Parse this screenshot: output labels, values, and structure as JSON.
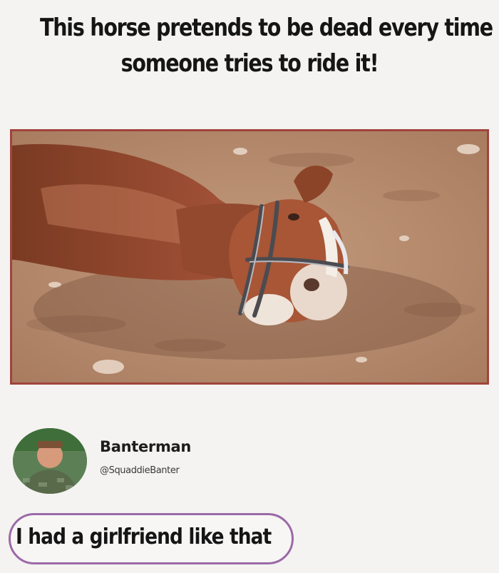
{
  "meme": {
    "headline_line1": "This horse pretends to be dead every time",
    "headline_line2": "someone tries to ride it!"
  },
  "post": {
    "username": "Banterman",
    "handle": "@SquaddieBanter",
    "comment": "I had a girlfriend like that"
  },
  "colors": {
    "photo_border": "#a0443c",
    "comment_border": "#9b6aa6",
    "background": "#f4f3f1"
  }
}
